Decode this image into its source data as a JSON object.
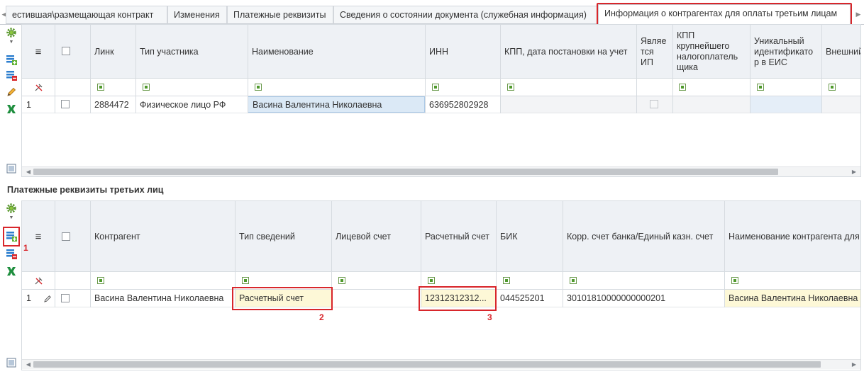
{
  "tabs": [
    {
      "label": "естившая\\размещающая контракт"
    },
    {
      "label": "Изменения"
    },
    {
      "label": "Платежные реквизиты"
    },
    {
      "label": "Сведения о состоянии документа (служебная информация)"
    },
    {
      "label": "Информация о контрагентах для оплаты третьим лицам",
      "active": true
    }
  ],
  "icons": {
    "tab_left": "chevron-left-icon",
    "tab_right": "chevron-right-icon",
    "settings": "gear-icon",
    "add": "add-row-icon",
    "delete": "delete-row-icon",
    "edit": "pencil-icon",
    "excel": "excel-icon",
    "menu": "hamburger-icon",
    "clear_filter": "clear-filter-icon"
  },
  "colors": {
    "accent_red": "#d8262b",
    "selected_cell": "#dbe9f6",
    "yellow_cell": "#fdf8d7",
    "filter_green": "#4f9a2c"
  },
  "top_grid": {
    "headers": {
      "menu": "≡",
      "link": "Линк",
      "participant_type": "Тип участника",
      "name": "Наименование",
      "inn": "ИНН",
      "kpp": "КПП, дата постановки на учет",
      "is_ip": "Являе тся ИП",
      "kpp_major": "КПП крупнейшего налогоплатель щика",
      "eis_id": "Уникальный идентификато р в ЕИС",
      "external": "Внешний"
    },
    "rows": [
      {
        "num": "1",
        "link": "2884472",
        "participant_type": "Физическое лицо РФ",
        "name": "Васина Валентина Николаевна",
        "inn": "636952802928",
        "kpp": "",
        "kpp_major": "",
        "eis_id": ""
      }
    ]
  },
  "bottom_section_title": "Платежные реквизиты третьих лиц",
  "bottom_grid": {
    "headers": {
      "menu": "≡",
      "counterparty": "Контрагент",
      "info_type": "Тип сведений",
      "personal_account": "Лицевой счет",
      "settlement_account": "Расчетный счет",
      "bik": "БИК",
      "corr_account": "Корр. счет банка/Единый казн. счет",
      "counterparty_name": "Наименование контрагента для"
    },
    "rows": [
      {
        "num": "1",
        "counterparty": "Васина Валентина Николаевна",
        "info_type": "Расчетный счет",
        "personal_account": "",
        "settlement_account": "12312312312...",
        "bik": "044525201",
        "corr_account": "30101810000000000201",
        "counterparty_name": "Васина Валентина Николаевна"
      }
    ]
  },
  "annotations": {
    "label_1": "1",
    "label_2": "2",
    "label_3": "3"
  }
}
